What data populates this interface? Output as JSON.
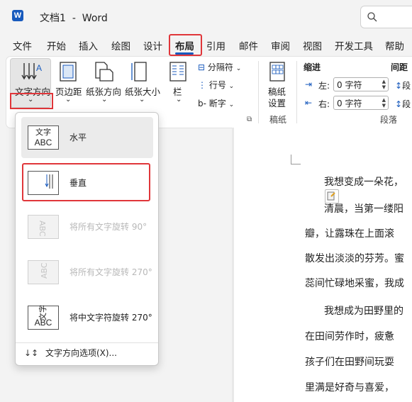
{
  "app": {
    "name": "Word",
    "doc_title": "文档1",
    "title_separator": "-"
  },
  "tabs": [
    {
      "label": "文件"
    },
    {
      "label": "开始"
    },
    {
      "label": "插入"
    },
    {
      "label": "绘图"
    },
    {
      "label": "设计"
    },
    {
      "label": "布局",
      "active": true
    },
    {
      "label": "引用"
    },
    {
      "label": "邮件"
    },
    {
      "label": "审阅"
    },
    {
      "label": "视图"
    },
    {
      "label": "开发工具"
    },
    {
      "label": "帮助"
    }
  ],
  "ribbon": {
    "text_direction": "文字方向",
    "margins": "页边距",
    "orientation": "纸张方向",
    "size": "纸张大小",
    "columns": "栏",
    "breaks": "分隔符",
    "line_numbers": "行号",
    "hyphenation": "断字",
    "draft_paper_line1": "稿纸",
    "draft_paper_line2": "设置",
    "draft_group": "稿纸",
    "indent_title": "缩进",
    "spacing_title": "间距",
    "indent_left_label": "左:",
    "indent_left_value": "0 字符",
    "indent_right_label": "右:",
    "indent_right_value": "0 字符",
    "spacing_before_partial": "段",
    "spacing_after_partial": "段",
    "paragraph_group": "段落"
  },
  "dropdown": {
    "items": [
      {
        "label": "水平",
        "icon": "text-horizontal-icon",
        "icon_text": [
          "文字",
          "ABC"
        ],
        "enabled": true,
        "selected": true
      },
      {
        "label": "垂直",
        "icon": "text-vertical-icon",
        "enabled": true,
        "selected": false
      },
      {
        "label": "将所有文字旋转 90°",
        "icon": "rotate-90-icon",
        "enabled": false
      },
      {
        "label": "将所有文字旋转 270°",
        "icon": "rotate-270-icon",
        "enabled": false
      },
      {
        "label": "将中文字符旋转 270°",
        "icon": "rotate-cjk-270-icon",
        "icon_text": [
          "文字",
          "ABC"
        ],
        "enabled": true
      }
    ],
    "options_label": "文字方向选项(X)..."
  },
  "document": {
    "lines": [
      "我想变成一朵花，",
      "清晨，当第一缕阳",
      "瓣，让露珠在上面滚",
      "散发出淡淡的芬芳。蜜",
      "蕊间忙碌地采蜜，我成",
      "我想成为田野里的",
      "在田间劳作时，疲惫",
      "孩子们在田野间玩耍",
      "里满是好奇与喜爱，"
    ]
  },
  "colors": {
    "accent": "#185abd",
    "highlight": "#e0363a"
  }
}
